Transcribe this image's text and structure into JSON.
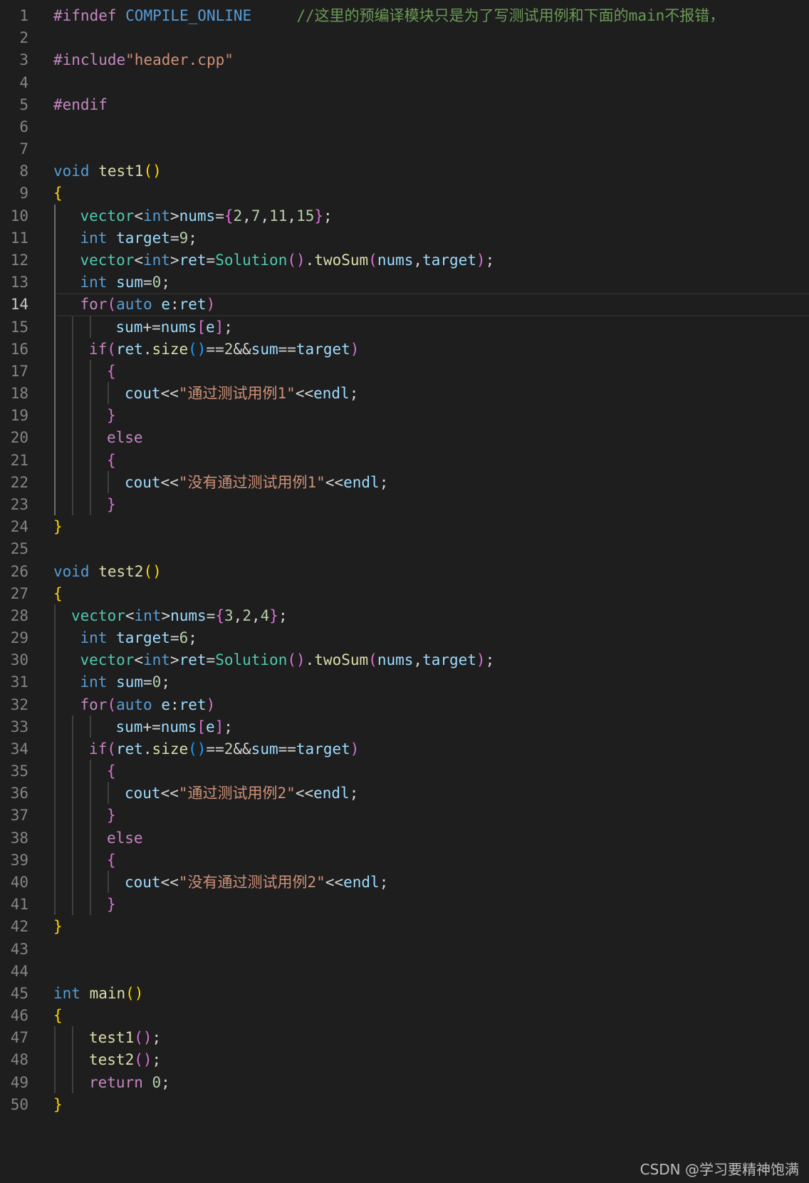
{
  "theme": {
    "background": "#1e1e1e",
    "line_number": "#858585",
    "line_number_active": "#c6c6c6",
    "colors": {
      "pp": "#c586c0",
      "macro": "#569cd6",
      "kw": "#569cd6",
      "ctl": "#c586c0",
      "type": "#4ec9b0",
      "fn": "#dcdcaa",
      "var": "#9cdcfe",
      "num": "#b5cea8",
      "str": "#ce9178",
      "cmt": "#6a9955",
      "op": "#d4d4d4",
      "br1": "#ffd700",
      "br2": "#da70d6",
      "br3": "#179fff"
    }
  },
  "editor": {
    "active_line": 14,
    "lines": [
      {
        "no": "1",
        "indent": 0,
        "tokens": [
          [
            "pp",
            "#ifndef "
          ],
          [
            "macro",
            "COMPILE_ONLINE"
          ],
          [
            "op",
            "     "
          ],
          [
            "cmt",
            "//这里的预编译模块只是为了写测试用例和下面的main不报错，  "
          ]
        ]
      },
      {
        "no": "2",
        "indent": 0,
        "tokens": []
      },
      {
        "no": "3",
        "indent": 0,
        "tokens": [
          [
            "pp",
            "#include"
          ],
          [
            "str",
            "\"header.cpp\""
          ]
        ]
      },
      {
        "no": "4",
        "indent": 0,
        "tokens": []
      },
      {
        "no": "5",
        "indent": 0,
        "tokens": [
          [
            "pp",
            "#endif"
          ]
        ]
      },
      {
        "no": "6",
        "indent": 0,
        "tokens": []
      },
      {
        "no": "7",
        "indent": 0,
        "tokens": []
      },
      {
        "no": "8",
        "indent": 0,
        "tokens": [
          [
            "kw",
            "void "
          ],
          [
            "fn",
            "test1"
          ],
          [
            "br1",
            "()"
          ]
        ]
      },
      {
        "no": "9",
        "indent": 0,
        "tokens": [
          [
            "br1",
            "{"
          ]
        ]
      },
      {
        "no": "10",
        "indent": 3,
        "tokens": [
          [
            "type",
            "vector"
          ],
          [
            "op",
            "<"
          ],
          [
            "kw",
            "int"
          ],
          [
            "op",
            ">"
          ],
          [
            "var",
            "nums"
          ],
          [
            "op",
            "="
          ],
          [
            "br2",
            "{"
          ],
          [
            "num",
            "2"
          ],
          [
            "op",
            ","
          ],
          [
            "num",
            "7"
          ],
          [
            "op",
            ","
          ],
          [
            "num",
            "11"
          ],
          [
            "op",
            ","
          ],
          [
            "num",
            "15"
          ],
          [
            "br2",
            "}"
          ],
          [
            "op",
            ";"
          ]
        ]
      },
      {
        "no": "11",
        "indent": 3,
        "tokens": [
          [
            "kw",
            "int "
          ],
          [
            "var",
            "target"
          ],
          [
            "op",
            "="
          ],
          [
            "num",
            "9"
          ],
          [
            "op",
            ";"
          ]
        ]
      },
      {
        "no": "12",
        "indent": 3,
        "tokens": [
          [
            "type",
            "vector"
          ],
          [
            "op",
            "<"
          ],
          [
            "kw",
            "int"
          ],
          [
            "op",
            ">"
          ],
          [
            "var",
            "ret"
          ],
          [
            "op",
            "="
          ],
          [
            "type",
            "Solution"
          ],
          [
            "br2",
            "()"
          ],
          [
            "op",
            "."
          ],
          [
            "fn",
            "twoSum"
          ],
          [
            "br2",
            "("
          ],
          [
            "var",
            "nums"
          ],
          [
            "op",
            ","
          ],
          [
            "var",
            "target"
          ],
          [
            "br2",
            ")"
          ],
          [
            "op",
            ";"
          ]
        ]
      },
      {
        "no": "13",
        "indent": 3,
        "tokens": [
          [
            "kw",
            "int "
          ],
          [
            "var",
            "sum"
          ],
          [
            "op",
            "="
          ],
          [
            "num",
            "0"
          ],
          [
            "op",
            ";"
          ]
        ]
      },
      {
        "no": "14",
        "indent": 3,
        "tokens": [
          [
            "ctl",
            "for"
          ],
          [
            "br2",
            "("
          ],
          [
            "kw",
            "auto "
          ],
          [
            "var",
            "e"
          ],
          [
            "op",
            ":"
          ],
          [
            "var",
            "ret"
          ],
          [
            "br2",
            ")"
          ]
        ]
      },
      {
        "no": "15",
        "indent": 7,
        "tokens": [
          [
            "var",
            "sum"
          ],
          [
            "op",
            "+="
          ],
          [
            "var",
            "nums"
          ],
          [
            "br2",
            "["
          ],
          [
            "var",
            "e"
          ],
          [
            "br2",
            "]"
          ],
          [
            "op",
            ";"
          ]
        ]
      },
      {
        "no": "16",
        "indent": 4,
        "tokens": [
          [
            "ctl",
            "if"
          ],
          [
            "br2",
            "("
          ],
          [
            "var",
            "ret"
          ],
          [
            "op",
            "."
          ],
          [
            "fn",
            "size"
          ],
          [
            "br3",
            "()"
          ],
          [
            "op",
            "=="
          ],
          [
            "num",
            "2"
          ],
          [
            "op",
            "&&"
          ],
          [
            "var",
            "sum"
          ],
          [
            "op",
            "=="
          ],
          [
            "var",
            "target"
          ],
          [
            "br2",
            ")"
          ]
        ]
      },
      {
        "no": "17",
        "indent": 6,
        "tokens": [
          [
            "br2",
            "{"
          ]
        ]
      },
      {
        "no": "18",
        "indent": 8,
        "tokens": [
          [
            "var",
            "cout"
          ],
          [
            "op",
            "<<"
          ],
          [
            "str",
            "\"通过测试用例1\""
          ],
          [
            "op",
            "<<"
          ],
          [
            "var",
            "endl"
          ],
          [
            "op",
            ";"
          ]
        ]
      },
      {
        "no": "19",
        "indent": 6,
        "tokens": [
          [
            "br2",
            "}"
          ]
        ]
      },
      {
        "no": "20",
        "indent": 6,
        "tokens": [
          [
            "ctl",
            "else"
          ]
        ]
      },
      {
        "no": "21",
        "indent": 6,
        "tokens": [
          [
            "br2",
            "{"
          ]
        ]
      },
      {
        "no": "22",
        "indent": 8,
        "tokens": [
          [
            "var",
            "cout"
          ],
          [
            "op",
            "<<"
          ],
          [
            "str",
            "\"没有通过测试用例1\""
          ],
          [
            "op",
            "<<"
          ],
          [
            "var",
            "endl"
          ],
          [
            "op",
            ";"
          ]
        ]
      },
      {
        "no": "23",
        "indent": 6,
        "tokens": [
          [
            "br2",
            "}"
          ]
        ]
      },
      {
        "no": "24",
        "indent": 0,
        "tokens": [
          [
            "br1",
            "}"
          ]
        ]
      },
      {
        "no": "25",
        "indent": 0,
        "tokens": []
      },
      {
        "no": "26",
        "indent": 0,
        "tokens": [
          [
            "kw",
            "void "
          ],
          [
            "fn",
            "test2"
          ],
          [
            "br1",
            "()"
          ]
        ]
      },
      {
        "no": "27",
        "indent": 0,
        "tokens": [
          [
            "br1",
            "{"
          ]
        ]
      },
      {
        "no": "28",
        "indent": 2,
        "tokens": [
          [
            "type",
            "vector"
          ],
          [
            "op",
            "<"
          ],
          [
            "kw",
            "int"
          ],
          [
            "op",
            ">"
          ],
          [
            "var",
            "nums"
          ],
          [
            "op",
            "="
          ],
          [
            "br2",
            "{"
          ],
          [
            "num",
            "3"
          ],
          [
            "op",
            ","
          ],
          [
            "num",
            "2"
          ],
          [
            "op",
            ","
          ],
          [
            "num",
            "4"
          ],
          [
            "br2",
            "}"
          ],
          [
            "op",
            ";"
          ]
        ]
      },
      {
        "no": "29",
        "indent": 3,
        "tokens": [
          [
            "kw",
            "int "
          ],
          [
            "var",
            "target"
          ],
          [
            "op",
            "="
          ],
          [
            "num",
            "6"
          ],
          [
            "op",
            ";"
          ]
        ]
      },
      {
        "no": "30",
        "indent": 3,
        "tokens": [
          [
            "type",
            "vector"
          ],
          [
            "op",
            "<"
          ],
          [
            "kw",
            "int"
          ],
          [
            "op",
            ">"
          ],
          [
            "var",
            "ret"
          ],
          [
            "op",
            "="
          ],
          [
            "type",
            "Solution"
          ],
          [
            "br2",
            "()"
          ],
          [
            "op",
            "."
          ],
          [
            "fn",
            "twoSum"
          ],
          [
            "br2",
            "("
          ],
          [
            "var",
            "nums"
          ],
          [
            "op",
            ","
          ],
          [
            "var",
            "target"
          ],
          [
            "br2",
            ")"
          ],
          [
            "op",
            ";"
          ]
        ]
      },
      {
        "no": "31",
        "indent": 3,
        "tokens": [
          [
            "kw",
            "int "
          ],
          [
            "var",
            "sum"
          ],
          [
            "op",
            "="
          ],
          [
            "num",
            "0"
          ],
          [
            "op",
            ";"
          ]
        ]
      },
      {
        "no": "32",
        "indent": 3,
        "tokens": [
          [
            "ctl",
            "for"
          ],
          [
            "br2",
            "("
          ],
          [
            "kw",
            "auto "
          ],
          [
            "var",
            "e"
          ],
          [
            "op",
            ":"
          ],
          [
            "var",
            "ret"
          ],
          [
            "br2",
            ")"
          ]
        ]
      },
      {
        "no": "33",
        "indent": 7,
        "tokens": [
          [
            "var",
            "sum"
          ],
          [
            "op",
            "+="
          ],
          [
            "var",
            "nums"
          ],
          [
            "br2",
            "["
          ],
          [
            "var",
            "e"
          ],
          [
            "br2",
            "]"
          ],
          [
            "op",
            ";"
          ]
        ]
      },
      {
        "no": "34",
        "indent": 4,
        "tokens": [
          [
            "ctl",
            "if"
          ],
          [
            "br2",
            "("
          ],
          [
            "var",
            "ret"
          ],
          [
            "op",
            "."
          ],
          [
            "fn",
            "size"
          ],
          [
            "br3",
            "()"
          ],
          [
            "op",
            "=="
          ],
          [
            "num",
            "2"
          ],
          [
            "op",
            "&&"
          ],
          [
            "var",
            "sum"
          ],
          [
            "op",
            "=="
          ],
          [
            "var",
            "target"
          ],
          [
            "br2",
            ")"
          ]
        ]
      },
      {
        "no": "35",
        "indent": 6,
        "tokens": [
          [
            "br2",
            "{"
          ]
        ]
      },
      {
        "no": "36",
        "indent": 8,
        "tokens": [
          [
            "var",
            "cout"
          ],
          [
            "op",
            "<<"
          ],
          [
            "str",
            "\"通过测试用例2\""
          ],
          [
            "op",
            "<<"
          ],
          [
            "var",
            "endl"
          ],
          [
            "op",
            ";"
          ]
        ]
      },
      {
        "no": "37",
        "indent": 6,
        "tokens": [
          [
            "br2",
            "}"
          ]
        ]
      },
      {
        "no": "38",
        "indent": 6,
        "tokens": [
          [
            "ctl",
            "else"
          ]
        ]
      },
      {
        "no": "39",
        "indent": 6,
        "tokens": [
          [
            "br2",
            "{"
          ]
        ]
      },
      {
        "no": "40",
        "indent": 8,
        "tokens": [
          [
            "var",
            "cout"
          ],
          [
            "op",
            "<<"
          ],
          [
            "str",
            "\"没有通过测试用例2\""
          ],
          [
            "op",
            "<<"
          ],
          [
            "var",
            "endl"
          ],
          [
            "op",
            ";"
          ]
        ]
      },
      {
        "no": "41",
        "indent": 6,
        "tokens": [
          [
            "br2",
            "}"
          ]
        ]
      },
      {
        "no": "42",
        "indent": 0,
        "tokens": [
          [
            "br1",
            "}"
          ]
        ]
      },
      {
        "no": "43",
        "indent": 0,
        "tokens": []
      },
      {
        "no": "44",
        "indent": 0,
        "tokens": []
      },
      {
        "no": "45",
        "indent": 0,
        "tokens": [
          [
            "kw",
            "int "
          ],
          [
            "fn",
            "main"
          ],
          [
            "br1",
            "()"
          ]
        ]
      },
      {
        "no": "46",
        "indent": 0,
        "tokens": [
          [
            "br1",
            "{"
          ]
        ]
      },
      {
        "no": "47",
        "indent": 4,
        "tokens": [
          [
            "fn",
            "test1"
          ],
          [
            "br2",
            "()"
          ],
          [
            "op",
            ";"
          ]
        ]
      },
      {
        "no": "48",
        "indent": 4,
        "tokens": [
          [
            "fn",
            "test2"
          ],
          [
            "br2",
            "()"
          ],
          [
            "op",
            ";"
          ]
        ]
      },
      {
        "no": "49",
        "indent": 4,
        "tokens": [
          [
            "ctl",
            "return "
          ],
          [
            "num",
            "0"
          ],
          [
            "op",
            ";"
          ]
        ]
      },
      {
        "no": "50",
        "indent": 0,
        "tokens": [
          [
            "br1",
            "}"
          ]
        ]
      }
    ]
  },
  "watermark": "CSDN @学习要精神饱满"
}
